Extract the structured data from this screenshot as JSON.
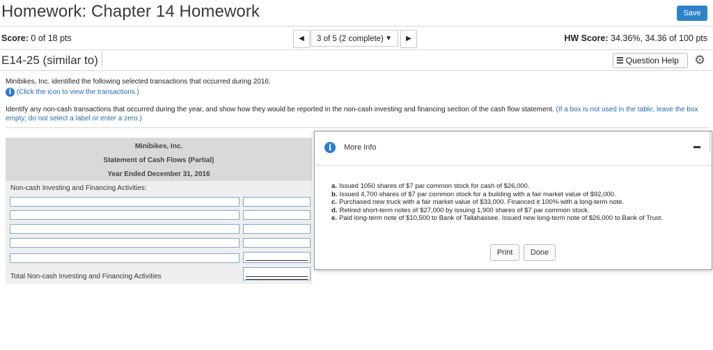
{
  "header": {
    "title": "Homework: Chapter 14 Homework",
    "save_label": "Save"
  },
  "scorebar": {
    "score_label": "Score:",
    "score_value": "0 of 18 pts",
    "nav_value": "3 of 5 (2 complete)",
    "hw_label": "HW Score:",
    "hw_value": "34.36%, 34.36 of 100 pts"
  },
  "question": {
    "id": "E14-25 (similar to)",
    "help_label": "Question Help"
  },
  "problem": {
    "intro": "Minibikes, Inc. identified the following selected transactions that occurred during 2016:",
    "click_text": "(Click the icon to view the transactions.)",
    "instruction": "Identify any non-cash transactions that occurred during the year, and show how they would be reported in the non-cash investing and financing section of the cash flow statement.",
    "instruction_note": "(If a box is not used in the table, leave the box empty; do not select a label or enter a zero.)"
  },
  "statement": {
    "company": "Minibikes, Inc.",
    "title": "Statement of Cash Flows (Partial)",
    "period": "Year Ended December 31, 2016",
    "section_label": "Non-cash Investing and Financing Activities:",
    "total_label": "Total Non-cash Investing and Financing Activities"
  },
  "modal": {
    "title": "More Info",
    "items": [
      {
        "letter": "a.",
        "text": "Issued 1050 shares of $7 par common stock for cash of $26,000."
      },
      {
        "letter": "b.",
        "text": "Issued 4,700 shares of $7 par common stock for a building with a fair market value of $92,000."
      },
      {
        "letter": "c.",
        "text": "Purchased new truck with a fair market value of $33,000. Financed it 100% with a long-term note."
      },
      {
        "letter": "d.",
        "text": "Retired short-term notes of $27,000 by issuing 1,900 shares of $7 par common stock."
      },
      {
        "letter": "e.",
        "text": "Paid long-term note of $10,500 to Bank of Tallahassee. Issued new long-term note of $26,000 to Bank of Trust."
      }
    ],
    "print_label": "Print",
    "done_label": "Done"
  },
  "colors": {
    "accent": "#2f83c9",
    "link": "#1c6bb1",
    "input_border": "#7fa7d1"
  }
}
